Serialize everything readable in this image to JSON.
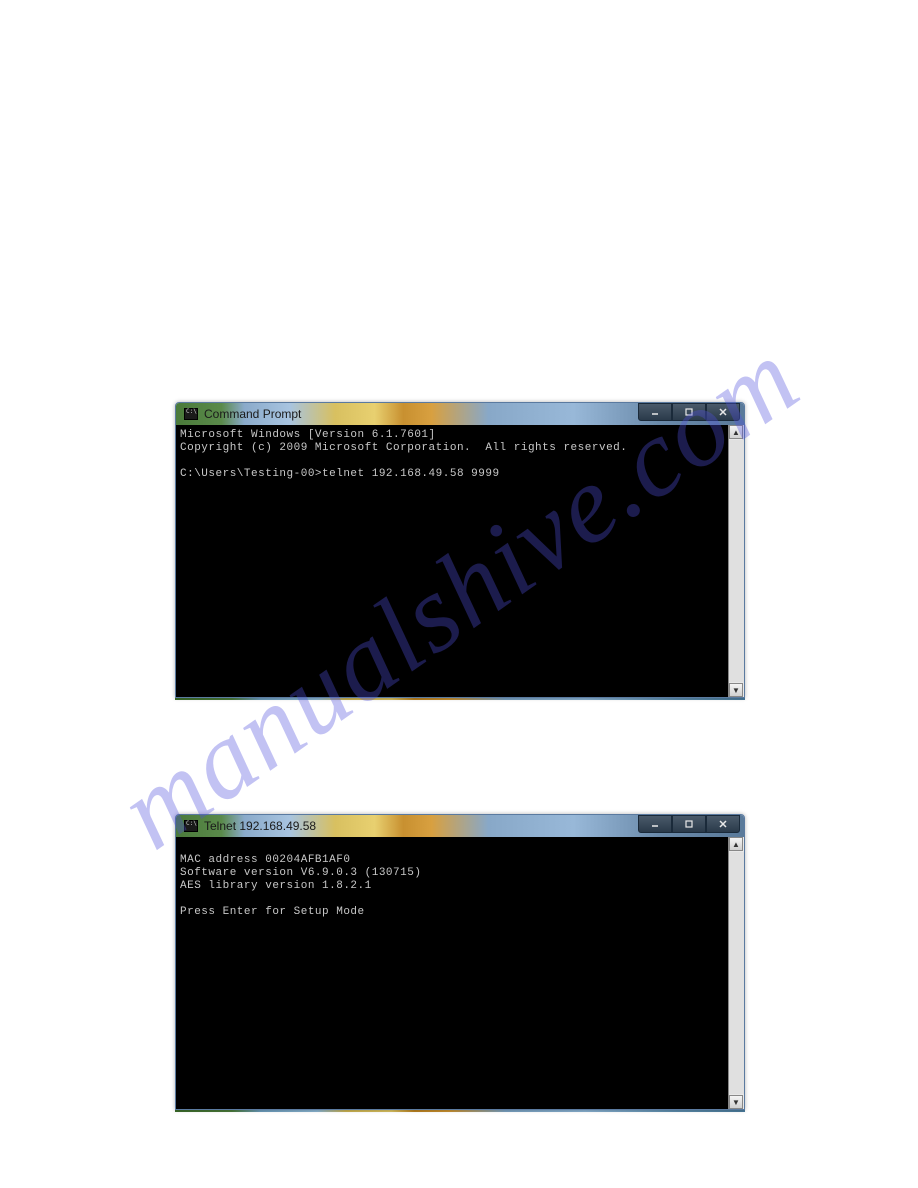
{
  "watermark": "manualshive.com",
  "window1": {
    "title": "Command Prompt",
    "lines": [
      "Microsoft Windows [Version 6.1.7601]",
      "Copyright (c) 2009 Microsoft Corporation.  All rights reserved.",
      "",
      "C:\\Users\\Testing-00>telnet 192.168.49.58 9999"
    ]
  },
  "window2": {
    "title": "Telnet 192.168.49.58",
    "lines": [
      "",
      "MAC address 00204AFB1AF0",
      "Software version V6.9.0.3 (130715)",
      "AES library version 1.8.2.1",
      "",
      "Press Enter for Setup Mode"
    ]
  },
  "controls": {
    "minimize": "minimize",
    "maximize": "maximize",
    "close": "close"
  }
}
